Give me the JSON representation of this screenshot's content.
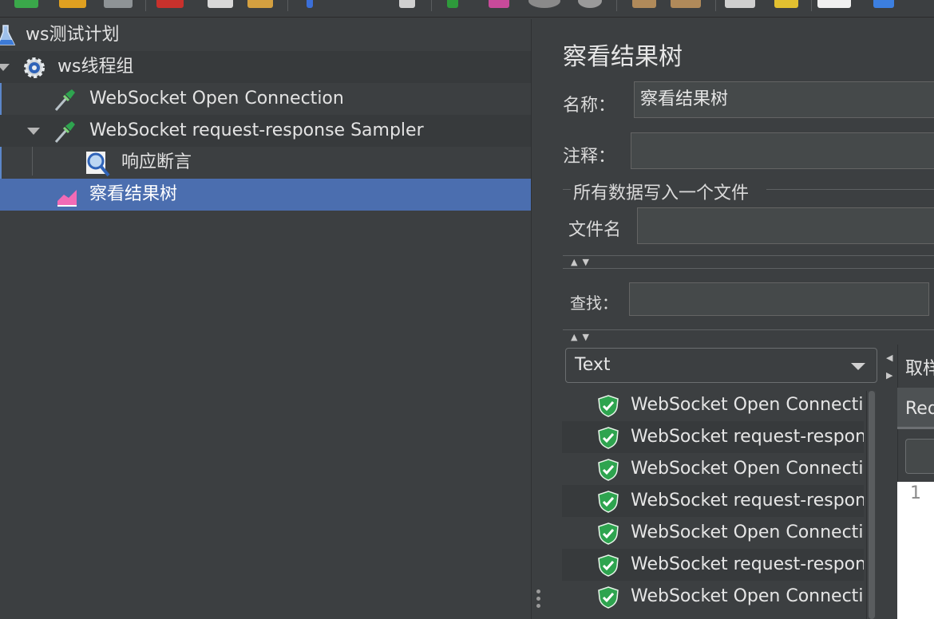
{
  "toolbar": {
    "icons": [
      "new-icon",
      "templates-icon",
      "save-icon",
      "cut-icon",
      "copy-icon",
      "paste-icon",
      "expand-icon",
      "toggle-icon",
      "start-icon",
      "start-no-pause-icon",
      "stop-icon",
      "shutdown-icon",
      "clear-icon",
      "clear-all-icon",
      "search-icon",
      "reset-search-icon",
      "function-helper-icon",
      "help-icon"
    ]
  },
  "tree": {
    "items": [
      {
        "label": "ws测试计划",
        "icon": "test-plan-icon"
      },
      {
        "label": "ws线程组",
        "icon": "thread-group-gear-icon"
      },
      {
        "label": "WebSocket Open Connection",
        "icon": "sampler-pipette-icon"
      },
      {
        "label": "WebSocket request-response Sampler",
        "icon": "sampler-pipette-icon"
      },
      {
        "label": "响应断言",
        "icon": "assertion-magnifier-icon"
      },
      {
        "label": "察看结果树",
        "icon": "listener-chart-icon"
      }
    ],
    "selected_index": 5
  },
  "panel": {
    "title": "察看结果树",
    "name_label": "名称：",
    "name_value": "察看结果树",
    "comment_label": "注释：",
    "comment_value": "",
    "file_group_label": "所有数据写入一个文件",
    "filename_label": "文件名",
    "filename_value": "",
    "search_label": "查找：",
    "search_value": "",
    "renderer_selected": "Text",
    "results": [
      "WebSocket Open Connecti",
      "WebSocket request-respon",
      "WebSocket Open Connecti",
      "WebSocket request-respon",
      "WebSocket Open Connecti",
      "WebSocket request-respon",
      "WebSocket Open Connecti"
    ],
    "sampler_tab_label": "取样",
    "request_tab_label": "Req",
    "editor_line_number": "1"
  },
  "colors": {
    "background": "#3c3f41",
    "selection": "#4b6eaf",
    "success_shield": "#2ea44f"
  }
}
